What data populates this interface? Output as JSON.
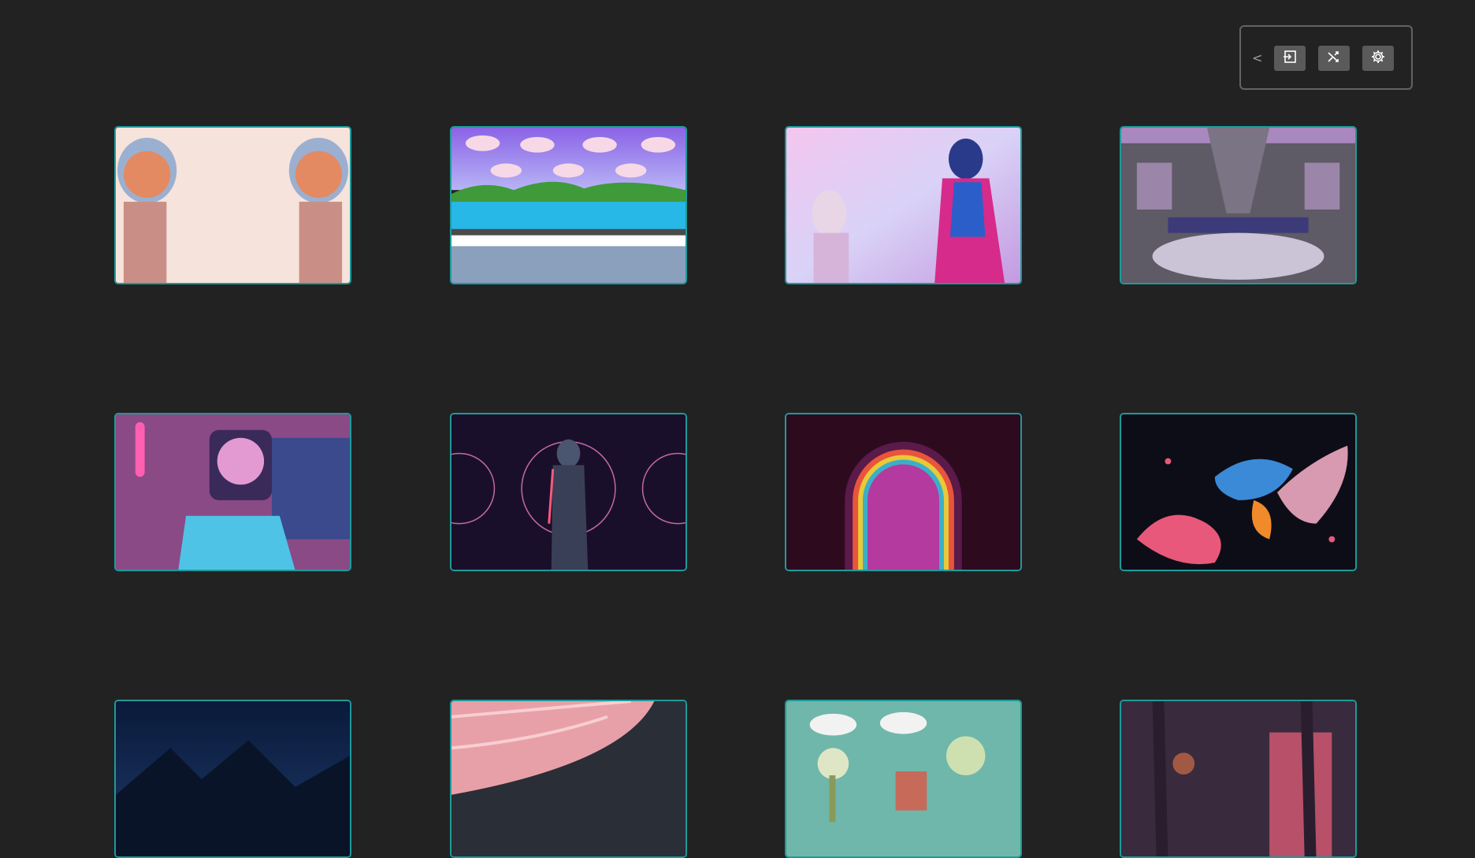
{
  "toolbar": {
    "collapse_label": "<",
    "buttons": [
      {
        "icon": "enter-icon",
        "name": "enter-button"
      },
      {
        "icon": "shuffle-icon",
        "name": "shuffle-button"
      },
      {
        "icon": "gear-icon",
        "name": "settings-button"
      }
    ]
  },
  "gallery": {
    "tiles": [
      {
        "name": "wallpaper-crystal-skulls"
      },
      {
        "name": "wallpaper-pixel-lake"
      },
      {
        "name": "wallpaper-vaporwave-statues"
      },
      {
        "name": "wallpaper-cloud-train"
      },
      {
        "name": "wallpaper-space-pool"
      },
      {
        "name": "wallpaper-neon-figure"
      },
      {
        "name": "wallpaper-rainbow-arch"
      },
      {
        "name": "wallpaper-fluid-paint"
      },
      {
        "name": "wallpaper-night-mountains"
      },
      {
        "name": "wallpaper-pink-beach"
      },
      {
        "name": "wallpaper-surreal-garden"
      },
      {
        "name": "wallpaper-neon-palms"
      }
    ]
  },
  "colors": {
    "background": "#222222",
    "tile_border": "#1e9a9a",
    "toolbar_border": "#5f6368",
    "button_bg": "#5a5a5a"
  }
}
